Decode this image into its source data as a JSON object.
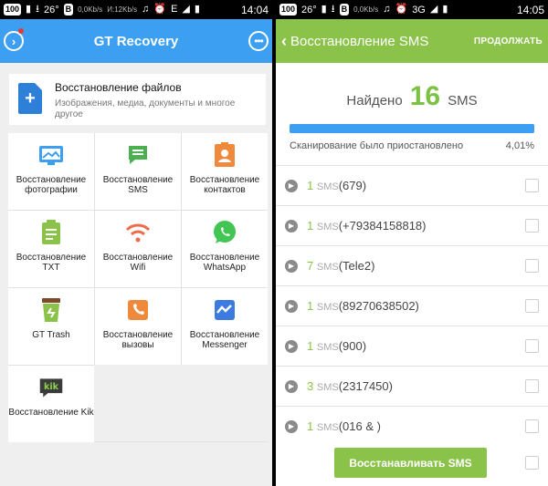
{
  "left": {
    "status": {
      "box": "100",
      "temp": "26°",
      "b_label": "B",
      "speed": "0,0Kb/s",
      "speed2": "И:12Kb/s",
      "ek_label": "E",
      "time": "14:04"
    },
    "appbar": {
      "title": "GT Recovery"
    },
    "file_recovery": {
      "title": "Восстановление файлов",
      "description": "Изображения, медиа, документы и многое другое"
    },
    "tiles": [
      {
        "label": "Восстановление фотографии",
        "icon": "photo-icon"
      },
      {
        "label": "Восстановление SMS",
        "icon": "sms-icon"
      },
      {
        "label": "Восстановление контактов",
        "icon": "contacts-icon"
      },
      {
        "label": "Восстановление TXT",
        "icon": "txt-icon"
      },
      {
        "label": "Восстановление Wifi",
        "icon": "wifi-icon"
      },
      {
        "label": "Восстановление WhatsApp",
        "icon": "whatsapp-icon"
      },
      {
        "label": "GT Trash",
        "icon": "trash-icon"
      },
      {
        "label": "Восстановление вызовы",
        "icon": "calls-icon"
      },
      {
        "label": "Восстановление Messenger",
        "icon": "messenger-icon"
      },
      {
        "label": "Восстановление Kik",
        "icon": "kik-icon"
      }
    ],
    "kik_logo": "kik"
  },
  "right": {
    "status": {
      "box": "100",
      "temp": "26°",
      "b_label": "B",
      "speed": "0,0Kb/s",
      "network": "3G",
      "time": "14:05"
    },
    "appbar": {
      "title": "Восстановление SMS",
      "continue": "ПРОДОЛЖАТЬ"
    },
    "found": {
      "prefix": "Найдено",
      "count": "16",
      "suffix": "SMS"
    },
    "progress": {
      "status": "Сканирование было приостановлено",
      "percent": "4,01%",
      "fill_fraction": 0.0401
    },
    "items": [
      {
        "count": "1",
        "unit": "SMS",
        "name": "(679)"
      },
      {
        "count": "1",
        "unit": "SMS",
        "name": "(+79384158818)"
      },
      {
        "count": "7",
        "unit": "SMS",
        "name": "(Tele2)"
      },
      {
        "count": "1",
        "unit": "SMS",
        "name": "(89270638502)"
      },
      {
        "count": "1",
        "unit": "SMS",
        "name": "(900)"
      },
      {
        "count": "3",
        "unit": "SMS",
        "name": "(2317450)"
      },
      {
        "count": "1",
        "unit": "SMS",
        "name": "(016 &      )"
      }
    ],
    "restore_button": "Восстанавливать SMS"
  },
  "colors": {
    "blue": "#3d9ff2",
    "green": "#8bc34a",
    "count_green": "#7cc242"
  }
}
